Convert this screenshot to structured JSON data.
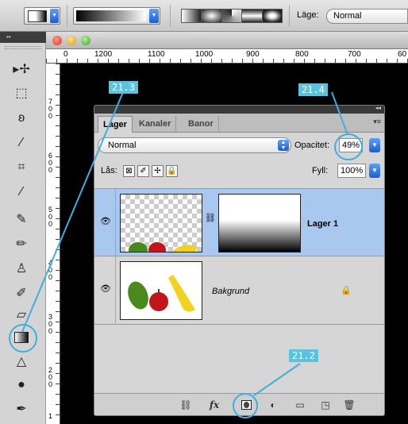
{
  "options_bar": {
    "mode_label": "Läge:",
    "mode_value": "Normal"
  },
  "tools": {
    "header": "••",
    "items": [
      {
        "name": "move-tool",
        "glyph": "▸✢"
      },
      {
        "name": "marquee-tool",
        "glyph": "⬚"
      },
      {
        "name": "lasso-tool",
        "glyph": "ʚ"
      },
      {
        "name": "quick-selection-tool",
        "glyph": "⁄"
      },
      {
        "name": "crop-tool",
        "glyph": "⌗"
      },
      {
        "name": "eyedropper-tool",
        "glyph": "⁄"
      },
      {
        "name": "healing-brush-tool",
        "glyph": "✎"
      },
      {
        "name": "brush-tool",
        "glyph": "✏"
      },
      {
        "name": "clone-stamp-tool",
        "glyph": "♙"
      },
      {
        "name": "history-brush-tool",
        "glyph": "✐"
      },
      {
        "name": "eraser-tool",
        "glyph": "▱"
      },
      {
        "name": "gradient-tool",
        "glyph": ""
      },
      {
        "name": "blur-tool",
        "glyph": "△"
      },
      {
        "name": "dodge-tool",
        "glyph": "●"
      },
      {
        "name": "pen-tool",
        "glyph": "✒"
      }
    ]
  },
  "document": {
    "ruler_h": [
      "0",
      "1200",
      "1100",
      "1000",
      "900",
      "800",
      "700",
      "60"
    ],
    "ruler_v": [
      "700",
      "600",
      "500",
      "400",
      "300",
      "200",
      "1"
    ]
  },
  "layers_panel": {
    "collapse_glyph": "◂◂",
    "menu_glyph": "▾≡",
    "tabs": [
      "Lager",
      "Kanaler",
      "Banor"
    ],
    "blend_mode": "Normal",
    "opacity_label": "Opacitet:",
    "opacity_value": "49%",
    "lock_label": "Lås:",
    "fill_label": "Fyll:",
    "fill_value": "100%",
    "layers": [
      {
        "name": "Lager 1",
        "visible": true,
        "selected": true
      },
      {
        "name": "Bakgrund",
        "visible": true,
        "locked": true
      }
    ]
  },
  "callouts": [
    "21.3",
    "21.4",
    "21.2"
  ],
  "colors": {
    "callout": "#5cc3df",
    "selected_layer": "#a8c8ef"
  }
}
